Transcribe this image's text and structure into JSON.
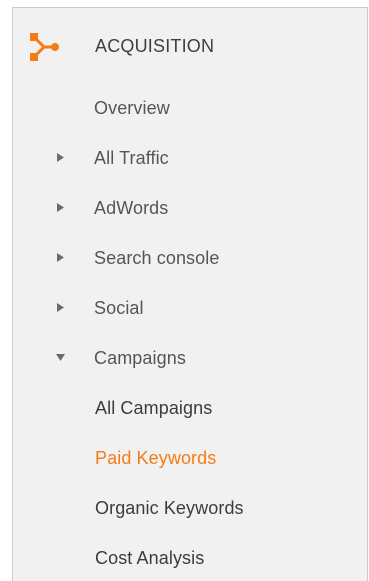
{
  "section": {
    "title": "ACQUISITION",
    "icon": "acquisition-branch-icon",
    "accent_color": "#f57c14"
  },
  "items": [
    {
      "label": "Overview",
      "expandable": false
    },
    {
      "label": "All Traffic",
      "expandable": true,
      "expanded": false
    },
    {
      "label": "AdWords",
      "expandable": true,
      "expanded": false
    },
    {
      "label": "Search console",
      "expandable": true,
      "expanded": false
    },
    {
      "label": "Social",
      "expandable": true,
      "expanded": false
    },
    {
      "label": "Campaigns",
      "expandable": true,
      "expanded": true
    }
  ],
  "subitems": [
    {
      "label": "All Campaigns",
      "active": false
    },
    {
      "label": "Paid Keywords",
      "active": true
    },
    {
      "label": "Organic Keywords",
      "active": false
    },
    {
      "label": "Cost Analysis",
      "active": false
    }
  ]
}
